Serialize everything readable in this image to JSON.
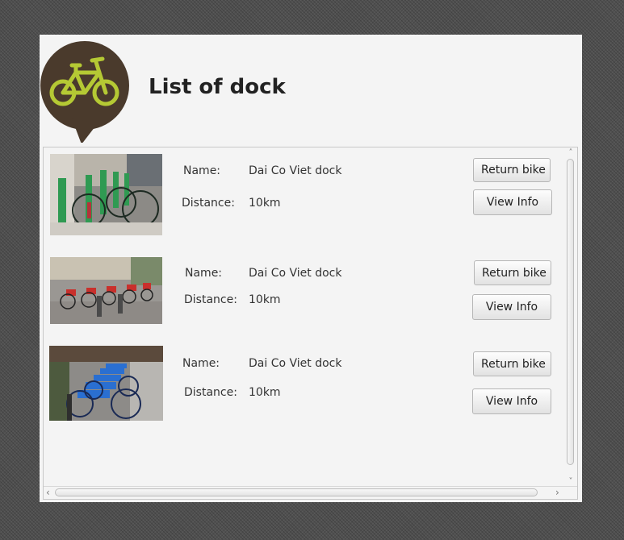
{
  "header": {
    "title": "List of dock",
    "logo_icon": "bike-speech-bubble-icon",
    "logo_colors": {
      "bubble": "#4a3a2c",
      "bike": "#b5c934"
    }
  },
  "docks": [
    {
      "name_label": "Name:",
      "name_value": "Dai Co Viet dock",
      "distance_label": "Distance:",
      "distance_value": "10km",
      "return_label": "Return bike",
      "view_label": "View Info",
      "photo": "green-bikes-rack-photo"
    },
    {
      "name_label": "Name:",
      "name_value": "Dai Co Viet dock",
      "distance_label": "Distance:",
      "distance_value": "10km",
      "return_label": "Return bike",
      "view_label": "View Info",
      "photo": "red-bikes-rack-photo"
    },
    {
      "name_label": "Name:",
      "name_value": "Dai Co Viet dock",
      "distance_label": "Distance:",
      "distance_value": "10km",
      "return_label": "Return bike",
      "view_label": "View Info",
      "photo": "blue-bikes-rack-photo"
    }
  ],
  "scrollbars": {
    "up_arrow": "˄",
    "down_arrow": "˅",
    "left_arrow": "‹",
    "right_arrow": "›"
  }
}
